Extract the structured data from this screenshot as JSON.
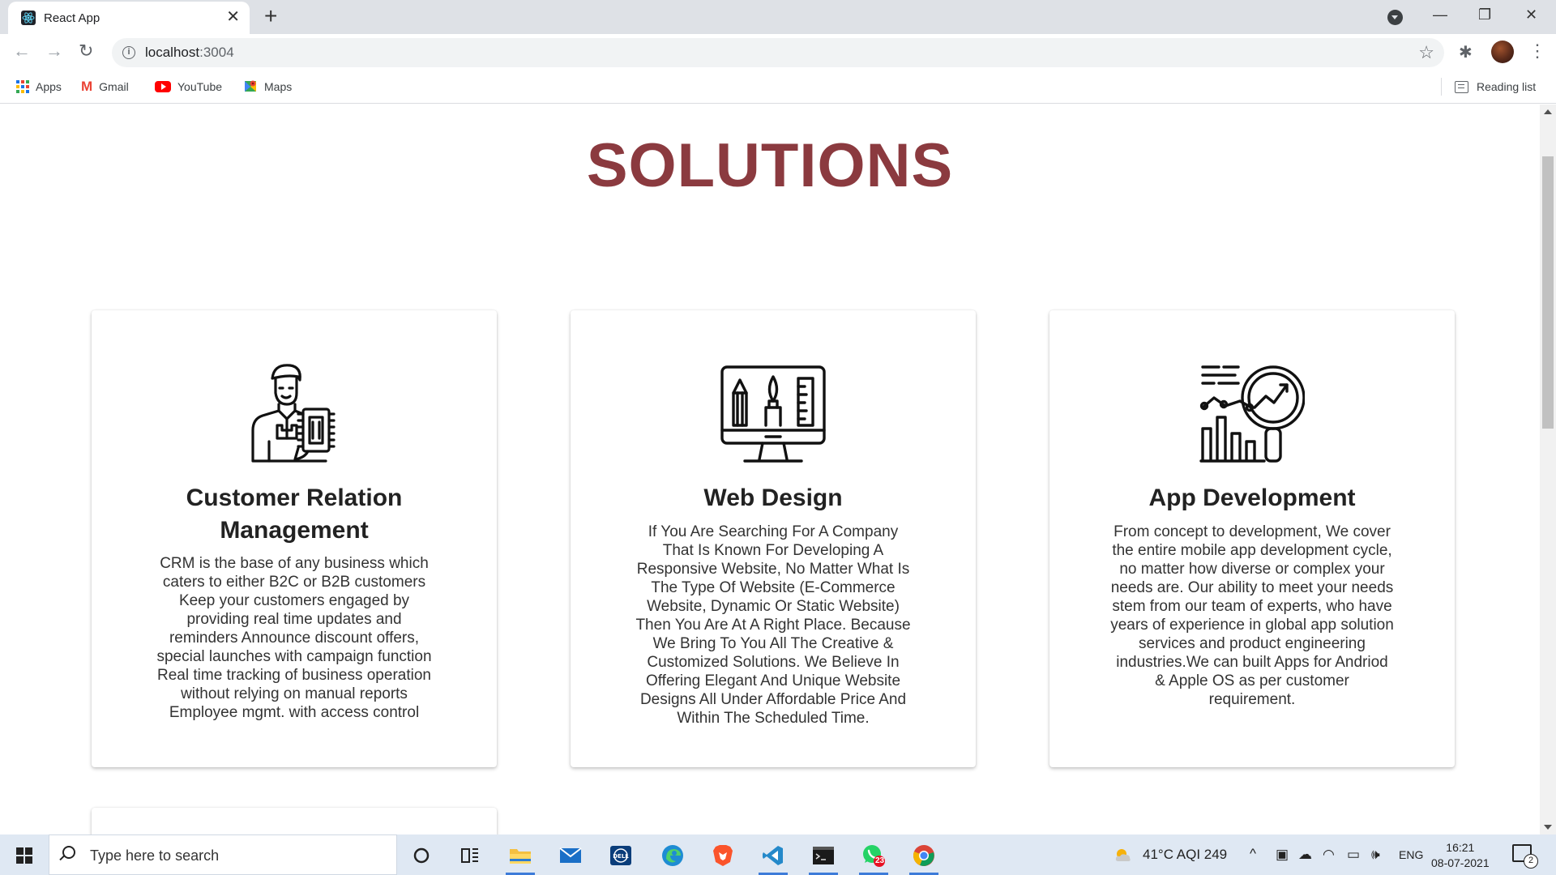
{
  "browser": {
    "tab_title": "React App",
    "tab_close": "✕",
    "new_tab": "+",
    "url_host": "localhost",
    "url_port": ":3004",
    "bookmarks": [
      {
        "label": "Apps",
        "icon": "apps-grid-icon"
      },
      {
        "label": "Gmail",
        "icon": "gmail-icon"
      },
      {
        "label": "YouTube",
        "icon": "youtube-icon"
      },
      {
        "label": "Maps",
        "icon": "maps-icon"
      }
    ],
    "reading_list": "Reading list"
  },
  "page": {
    "heading": "SOLUTIONS",
    "accent_color": "#8b3a3f",
    "cards": [
      {
        "title": "Customer Relation Management",
        "icon": "customer-support-icon",
        "text": "CRM is the base of any business which caters to either B2C or B2B customers Keep your customers engaged by providing real time updates and reminders Announce discount offers, special launches with campaign function Real time tracking of business operation without relying on manual reports Employee mgmt. with access control"
      },
      {
        "title": "Web Design",
        "icon": "monitor-design-tools-icon",
        "text": "If You Are Searching For A Company That Is Known For Developing A Responsive Website, No Matter What Is The Type Of Website (E-Commerce Website, Dynamic Or Static Website) Then You Are At A Right Place. Because We Bring To You All The Creative & Customized Solutions. We Believe In Offering Elegant And Unique Website Designs All Under Affordable Price And Within The Scheduled Time."
      },
      {
        "title": "App Development",
        "icon": "analytics-magnifier-icon",
        "text": "From concept to development, We cover the entire mobile app development cycle, no matter how diverse or complex your needs are. Our ability to meet your needs stem from our team of experts, who have years of experience in global app solution services and product engineering industries.We can built Apps for Andriod & Apple OS as per customer requirement."
      }
    ]
  },
  "taskbar": {
    "search_placeholder": "Type here to search",
    "weather": "41°C  AQI 249",
    "language": "ENG",
    "time": "16:21",
    "date": "08-07-2021",
    "whatsapp_badge": "23",
    "notification_count": "2"
  }
}
